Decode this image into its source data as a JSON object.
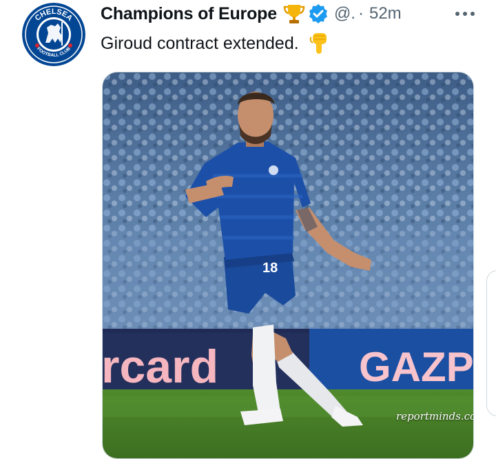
{
  "tweet": {
    "author_name": "Champions of Europe",
    "handle": "@.",
    "separator": "·",
    "timestamp": "52m",
    "text": "Giroud contract extended.",
    "badge_icons": [
      "trophy-icon",
      "verified-icon"
    ],
    "emoji": "backhand-index-pointing-down-icon",
    "more_icon": "more-options-icon"
  },
  "avatar": {
    "icon": "chelsea-crest-icon",
    "crest_text": "CHELSEA",
    "crest_subtext": "FOOTBALL CLUB"
  },
  "media": {
    "watermark": "reportminds.com",
    "banner_left": "rcard",
    "banner_right": "GAZP",
    "shirt_number": "18"
  },
  "colors": {
    "accent_blue": "#1d9bf0",
    "chelsea_blue": "#034694",
    "text_primary": "#0f1419",
    "text_secondary": "#536471"
  }
}
